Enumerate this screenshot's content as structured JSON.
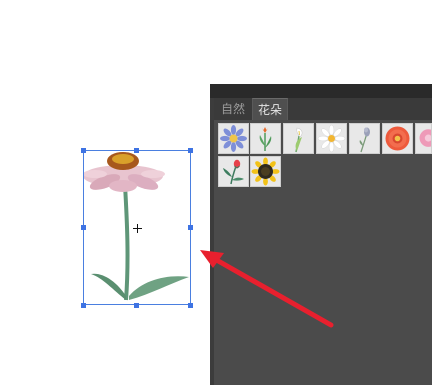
{
  "panel": {
    "tabs": [
      {
        "label": "自然",
        "active": false
      },
      {
        "label": "花朵",
        "active": true
      }
    ]
  },
  "symbols": [
    {
      "icon": "blue-aster-icon"
    },
    {
      "icon": "tulip-stem-icon"
    },
    {
      "icon": "calla-lily-icon"
    },
    {
      "icon": "daisy-icon"
    },
    {
      "icon": "lavender-stem-icon"
    },
    {
      "icon": "red-gerbera-icon"
    },
    {
      "icon": "pink-flower-partial-icon"
    },
    {
      "icon": "red-bud-stem-icon"
    },
    {
      "icon": "sunflower-icon"
    }
  ],
  "colors": {
    "panel_bg": "#4b4b4b",
    "selection": "#4a7fe0",
    "arrow": "#e8202e"
  }
}
